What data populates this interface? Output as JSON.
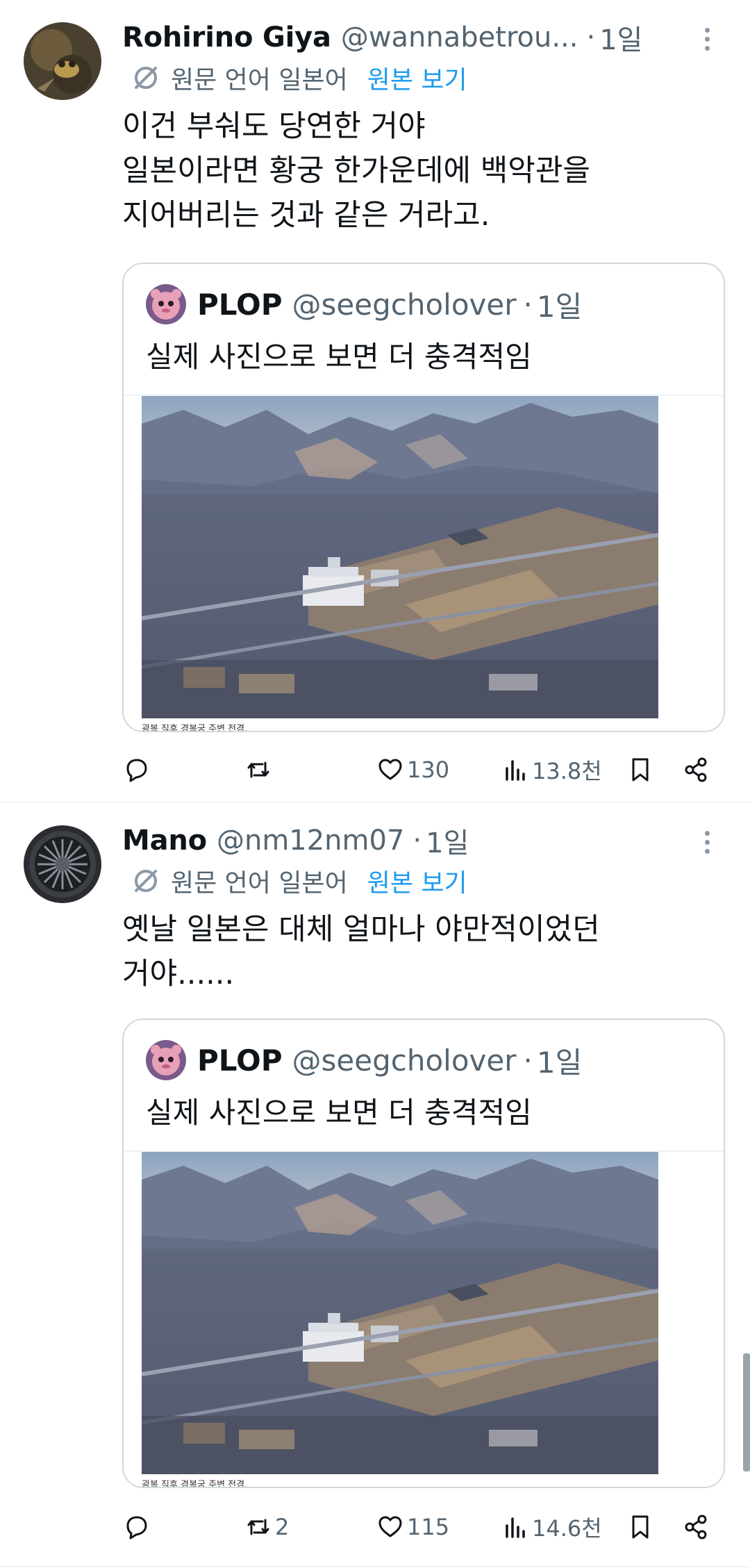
{
  "tweets": [
    {
      "name": "Rohirino Giya",
      "handle": "@wannabetrou...",
      "dot": "·",
      "time": "1일",
      "translate_lang": "원문 언어 일본어",
      "translate_action": "원본 보기",
      "text": "이건 부숴도 당연한 거야\n일본이라면 황궁 한가운데에 백악관을\n지어버리는 것과 같은 거라고.",
      "quote": {
        "name": "PLOP",
        "handle": "@seegcholover",
        "dot": "·",
        "time": "1일",
        "text": "실제 사진으로 보면 더 충격적임",
        "caption": "광복 직후 경복궁 주변 전경."
      },
      "stats": {
        "reply": "",
        "retweet": "",
        "like": "130",
        "views": "13.8천"
      }
    },
    {
      "name": "Mano",
      "handle": "@nm12nm07",
      "dot": "·",
      "time": "1일",
      "translate_lang": "원문 언어 일본어",
      "translate_action": "원본 보기",
      "text": "옛날 일본은 대체 얼마나 야만적이었던\n거야......",
      "quote": {
        "name": "PLOP",
        "handle": "@seegcholover",
        "dot": "·",
        "time": "1일",
        "text": "실제 사진으로 보면 더 충격적임",
        "caption": "광복 직후 경복궁 주변 전경."
      },
      "stats": {
        "reply": "",
        "retweet": "2",
        "like": "115",
        "views": "14.6천"
      }
    }
  ],
  "icons": {
    "translate": "translate-icon",
    "reply": "reply-icon",
    "retweet": "retweet-icon",
    "like": "heart-icon",
    "views": "views-icon",
    "bookmark": "bookmark-icon",
    "share": "share-icon",
    "more": "more-icon"
  },
  "colors": {
    "text": "#0f1419",
    "secondary": "#536471",
    "link": "#1d9bf0",
    "border": "#cfd9de"
  }
}
